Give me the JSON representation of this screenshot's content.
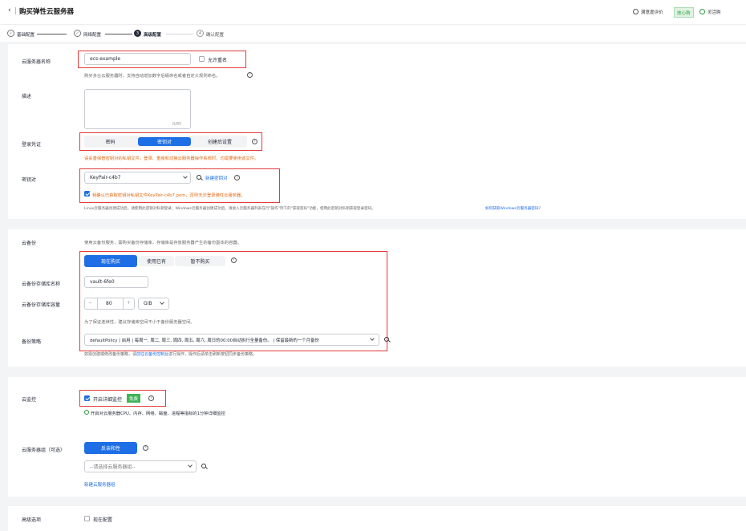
{
  "header": {
    "title": "购买弹性云服务器",
    "satisfaction": "满意度评价",
    "tag": "放心购",
    "shortcut": "灵活购"
  },
  "steps": [
    {
      "num": "",
      "label": "基础配置",
      "state": "done"
    },
    {
      "num": "",
      "label": "网络配置",
      "state": "done"
    },
    {
      "num": "3",
      "label": "高级配置",
      "state": "active"
    },
    {
      "num": "4",
      "label": "确认配置",
      "state": "todo"
    }
  ],
  "server_name": {
    "label": "云服务器名称",
    "value": "ecs-example",
    "allow_dup": "允许重名",
    "hint": "购买多台云服务器时，支持自动增加数字后缀命名或者自定义规则命名。"
  },
  "description": {
    "label": "描述",
    "counter": "0/85"
  },
  "login": {
    "label": "登录凭证",
    "options": [
      "密码",
      "密钥对",
      "创建后设置"
    ],
    "selected": "密钥对",
    "warning": "请妥善保管密钥对的私钥文件，登录、重装和切换云服务器操作系统时，均需要使用该文件。"
  },
  "keypair": {
    "label": "密钥对",
    "value": "KeyPair-c4b7",
    "new_link": "新建密钥对",
    "confirm": "我确认已获取密钥对私钥文件KeyPair-c4b7.pem，否则无法登录弹性云服务器。",
    "hint": "Linux云服务器创建成功后，请使用此密钥对私钥登录；Windows云服务器创建成功后，请进入云服务器列表在行\"操作\"列下的\"获取密码\"功能，使用此密钥对私钥获取登录密码。",
    "hint_link": "如何获取Windows云服务器密码?"
  },
  "backup": {
    "label": "云备份",
    "intro": "使用云备份服务，需购买备份存储库，存储库是存放服务器产生的备份副本的容器。",
    "options": [
      "现在购买",
      "使用已有",
      "暂不购买"
    ],
    "selected": "现在购买",
    "vault_label": "云备份存储库名称",
    "vault_value": "vault-6fe0",
    "capacity_label": "云备份存储库容量",
    "capacity_minus": "−",
    "capacity_value": "80",
    "capacity_plus": "+",
    "capacity_unit": "GiB",
    "capacity_hint": "为了保证连续性，建议存储库空间不小于备份服务器空间。",
    "policy_label": "备份策略",
    "policy_value": "defaultPolicy | 启用 | 每周一, 周二, 周三, 周四, 周五, 周六, 周日的00:00自动执行全量备份。 | 保留最新的一个月备份",
    "policy_hint_pre": "如需创建或修改备份策略，请",
    "policy_hint_link": "前往云备份控制台",
    "policy_hint_post": "进行操作，操作后请单击刷新按钮同步备份策略。"
  },
  "monitor": {
    "label": "云监控",
    "option": "开启详细监控",
    "badge": "免费",
    "detail": "开启对云服务器CPU、内存、网络、磁盘、进程等指标的1分钟详细监控"
  },
  "server_group": {
    "label": "云服务器组（可选）",
    "button": "反亲和性",
    "placeholder": "--请选择云服务器组--",
    "new_link": "新建云服务器组"
  },
  "advanced": {
    "label": "高级选项",
    "option": "现在配置"
  }
}
